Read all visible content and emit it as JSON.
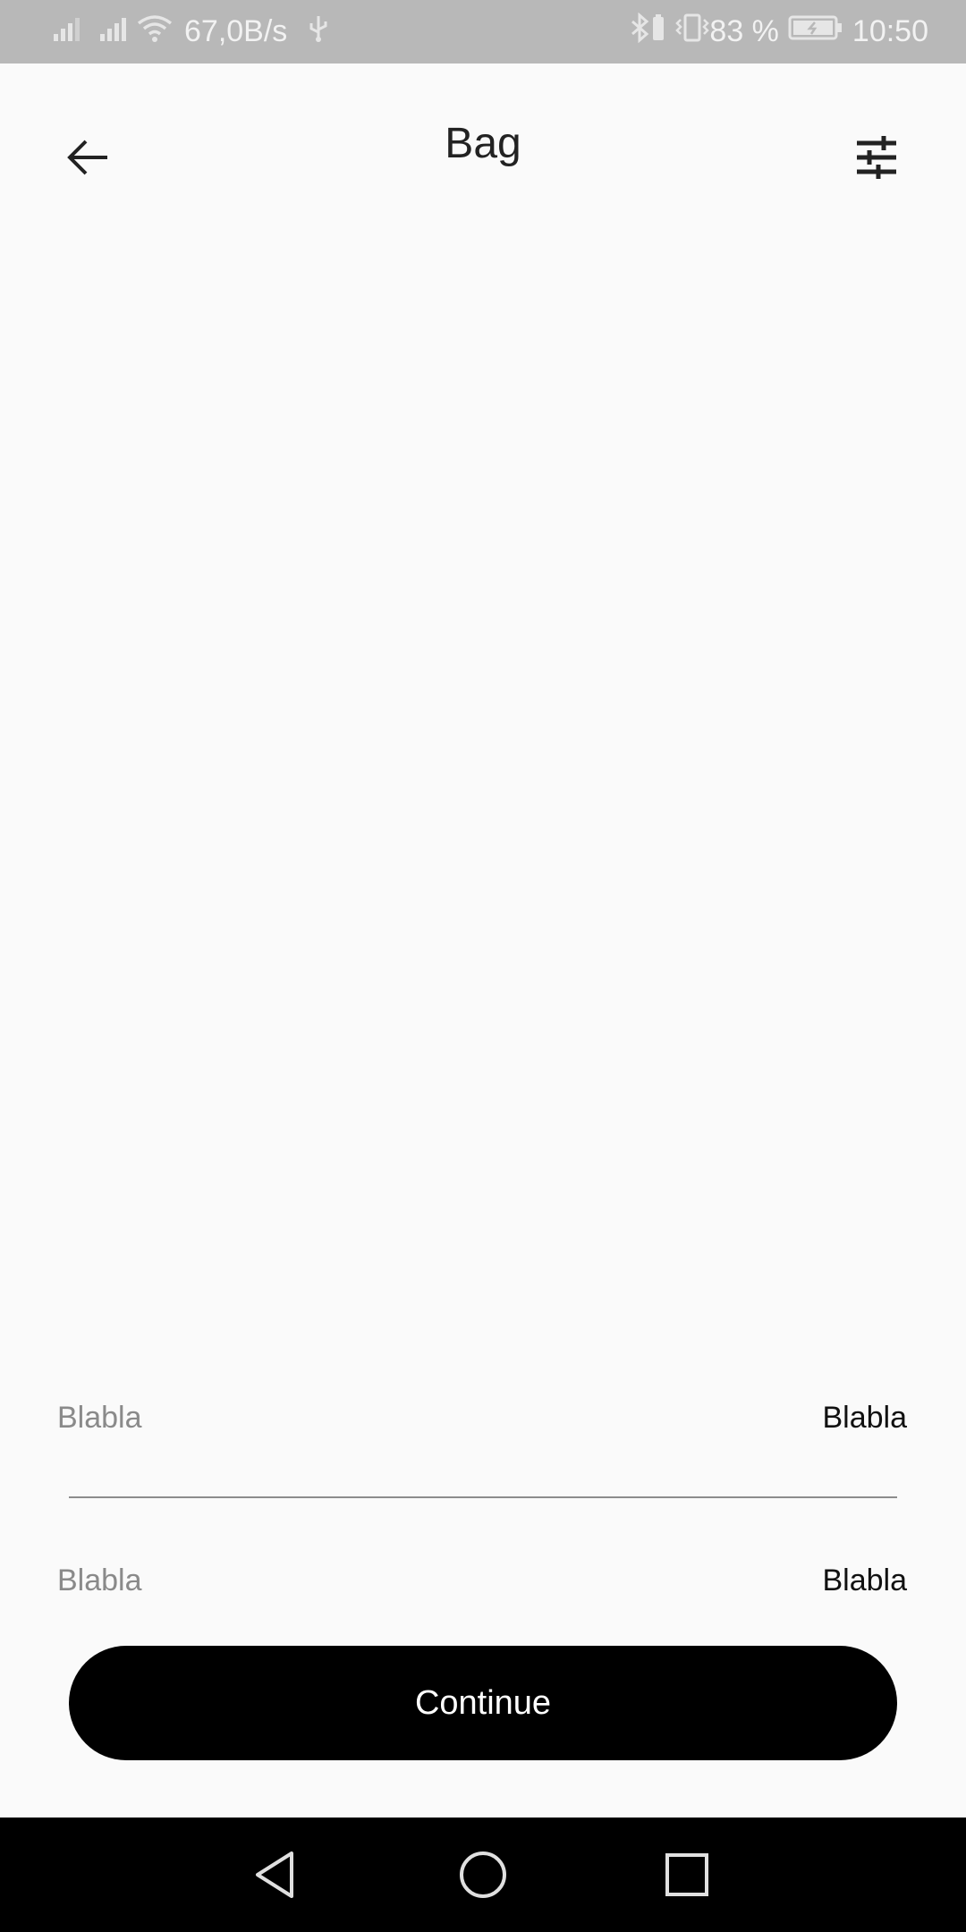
{
  "status_bar": {
    "net_speed": "67,0B/s",
    "battery": "83 %",
    "time": "10:50",
    "icons": [
      "signal-icon",
      "signal-icon",
      "wifi-icon",
      "usb-icon",
      "bluetooth-icon",
      "battery-saver-icon",
      "vibrate-icon",
      "battery-icon"
    ]
  },
  "header": {
    "title": "Bag",
    "back_icon": "arrow-left-icon",
    "filter_icon": "sliders-icon"
  },
  "summary": {
    "rows": [
      {
        "label": "Blabla",
        "value": "Blabla"
      },
      {
        "label": "Blabla",
        "value": "Blabla"
      }
    ]
  },
  "actions": {
    "continue_label": "Continue"
  },
  "nav_bar": {
    "icons": [
      "nav-back-icon",
      "nav-home-icon",
      "nav-recent-icon"
    ]
  },
  "colors": {
    "background": "#fafafa",
    "status_bar": "#b8b8b8",
    "button": "#000000",
    "button_text": "#ffffff",
    "label_muted": "#8a8a8a"
  }
}
